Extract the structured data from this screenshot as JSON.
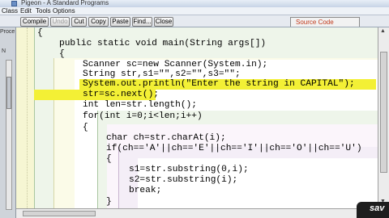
{
  "window": {
    "title": "Pigeon - A Standard Programs"
  },
  "menu": [
    {
      "label": "Class"
    },
    {
      "label": "Edit"
    },
    {
      "label": "Tools"
    },
    {
      "label": "Options"
    }
  ],
  "toolbar": {
    "buttons": [
      {
        "label": "Compile",
        "enabled": true
      },
      {
        "label": "Undo",
        "enabled": false
      },
      {
        "label": "Cut",
        "enabled": true
      },
      {
        "label": "Copy",
        "enabled": true
      },
      {
        "label": "Paste",
        "enabled": true
      },
      {
        "label": "Find...",
        "enabled": true
      },
      {
        "label": "Close",
        "enabled": true
      }
    ],
    "source_tab": "Source Code"
  },
  "left_panel": {
    "label_top": "Proce",
    "label_mid": "N"
  },
  "code_lines": [
    "{",
    "public static void main(String args[])",
    "{",
    "Scanner sc=new Scanner(System.in);",
    "String str,s1=\"\",s2=\"\",s3=\"\";",
    "System.out.println(\"Enter the string in CAPITAL\");",
    "str=sc.next();",
    "int len=str.length();",
    "for(int i=0;i<len;i++)",
    "{",
    "char ch=str.charAt(i);",
    "if(ch=='A'||ch=='E'||ch=='I'||ch=='O'||ch=='U')",
    "{",
    "s1=str.substring(0,i);",
    "s2=str.substring(i);",
    "break;",
    "}"
  ],
  "overlay": {
    "text": "sav"
  },
  "colors": {
    "highlight": "#f3f035",
    "editor_bg": "#f6f6d3",
    "tab_text": "#c0391b"
  }
}
